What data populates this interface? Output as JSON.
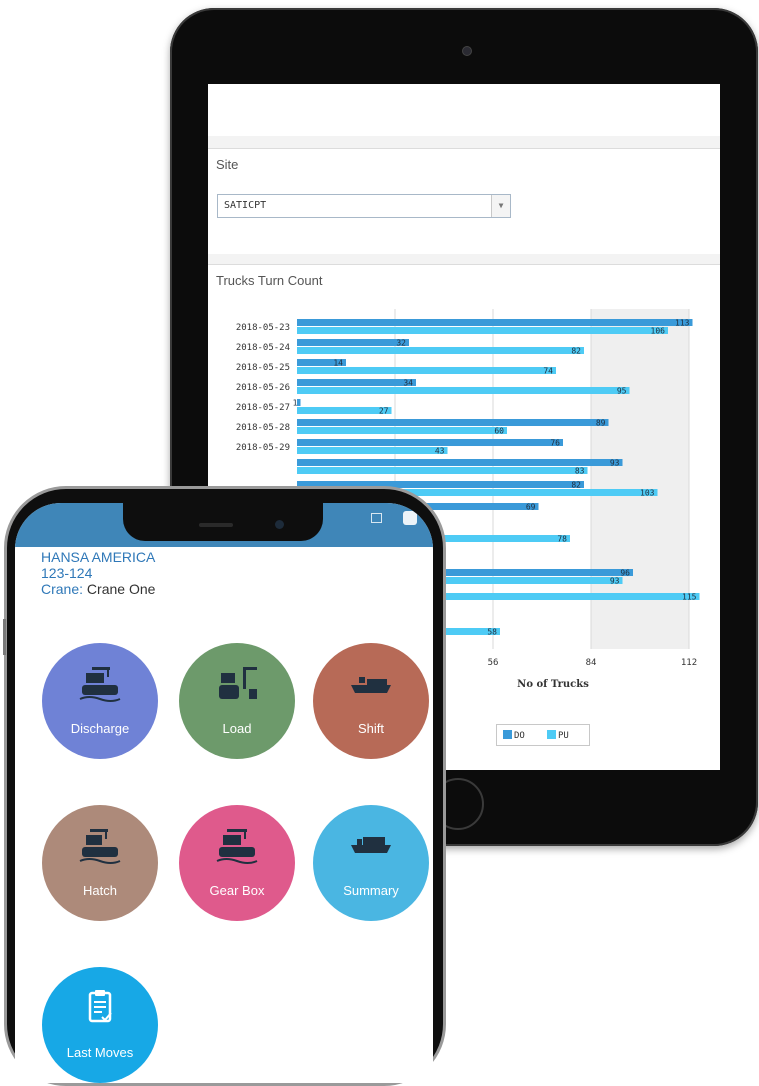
{
  "tablet": {
    "site_header": "Site",
    "site_select_value": "SATICPT",
    "chart_header": "Trucks Turn Count",
    "legend": {
      "do_label": "DO",
      "pu_label": "PU"
    }
  },
  "chart_data": {
    "type": "bar",
    "orientation": "horizontal",
    "xlabel": "No of Trucks",
    "xlim": [
      0,
      112
    ],
    "x_ticks": [
      56,
      84,
      112
    ],
    "categories": [
      "2018-05-23",
      "2018-05-24",
      "2018-05-25",
      "2018-05-26",
      "2018-05-27",
      "2018-05-28",
      "2018-05-29"
    ],
    "series": [
      {
        "name": "DO",
        "color": "#3a9ad9",
        "values": [
          113,
          32,
          14,
          34,
          1,
          89,
          76
        ]
      },
      {
        "name": "PU",
        "color": "#4ecbf5",
        "values": [
          106,
          82,
          74,
          95,
          27,
          60,
          43
        ]
      }
    ],
    "visible_bar_labels_lower_rows": [
      {
        "series": "DO",
        "value": 93
      },
      {
        "series": "PU",
        "value": 83
      },
      {
        "series": "DO",
        "value": 82
      },
      {
        "series": "PU",
        "value": 103
      },
      {
        "series": "DO",
        "value": 69
      },
      {
        "series": "PU",
        "value": 78
      },
      {
        "series": "DO",
        "value": 96
      },
      {
        "series": "PU",
        "value": 93
      },
      {
        "series": "PU",
        "value": 115
      },
      {
        "series": "PU",
        "value": 58
      }
    ]
  },
  "phone": {
    "vessel_name": "HANSA AMERICA",
    "voyage": "123-124",
    "crane_label": "Crane:",
    "crane_value": "Crane One",
    "tiles": [
      {
        "label": "Discharge",
        "color": "#6f82d6",
        "icon": "ship-discharge-icon"
      },
      {
        "label": "Load",
        "color": "#6d9a6b",
        "icon": "ship-load-icon"
      },
      {
        "label": "Shift",
        "color": "#b76a57",
        "icon": "container-ship-icon"
      },
      {
        "label": "Hatch",
        "color": "#ad8a7a",
        "icon": "ship-hatch-icon"
      },
      {
        "label": "Gear Box",
        "color": "#df5a8c",
        "icon": "ship-crane-icon"
      },
      {
        "label": "Summary",
        "color": "#4ab6e2",
        "icon": "cargo-ship-icon"
      },
      {
        "label": "Last Moves",
        "color": "#17a8e6",
        "icon": "clipboard-icon"
      }
    ]
  }
}
